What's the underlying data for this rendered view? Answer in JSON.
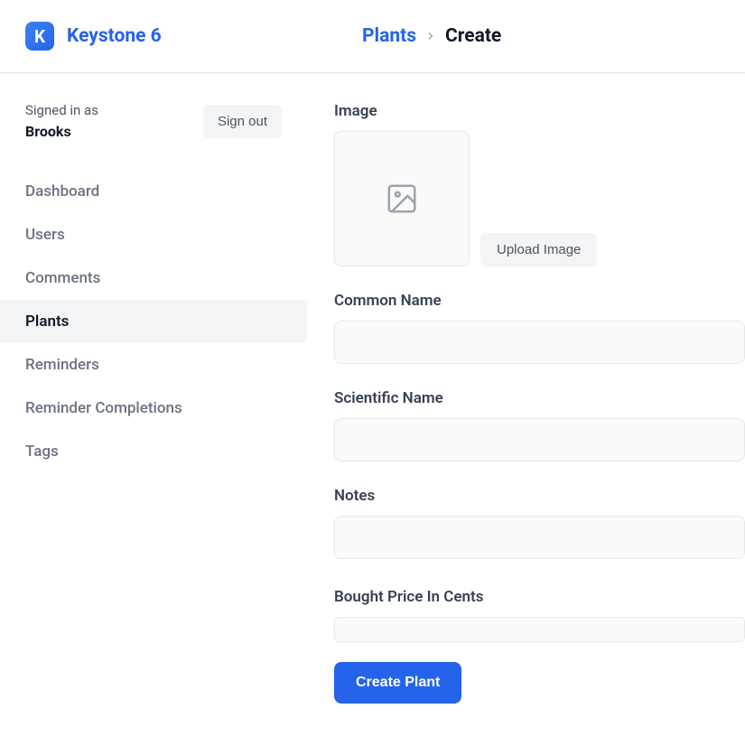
{
  "brand": {
    "logo_letter": "K",
    "title": "Keystone 6"
  },
  "breadcrumb": {
    "parent": "Plants",
    "current": "Create"
  },
  "auth": {
    "signed_in_label": "Signed in as",
    "username": "Brooks",
    "signout_label": "Sign out"
  },
  "nav": {
    "items": [
      {
        "label": "Dashboard",
        "active": false
      },
      {
        "label": "Users",
        "active": false
      },
      {
        "label": "Comments",
        "active": false
      },
      {
        "label": "Plants",
        "active": true
      },
      {
        "label": "Reminders",
        "active": false
      },
      {
        "label": "Reminder Completions",
        "active": false
      },
      {
        "label": "Tags",
        "active": false
      }
    ]
  },
  "form": {
    "image": {
      "label": "Image",
      "upload_button": "Upload Image"
    },
    "common_name": {
      "label": "Common Name",
      "value": ""
    },
    "scientific_name": {
      "label": "Scientific Name",
      "value": ""
    },
    "notes": {
      "label": "Notes",
      "value": ""
    },
    "bought_price": {
      "label": "Bought Price In Cents",
      "value": ""
    },
    "submit_label": "Create Plant"
  }
}
